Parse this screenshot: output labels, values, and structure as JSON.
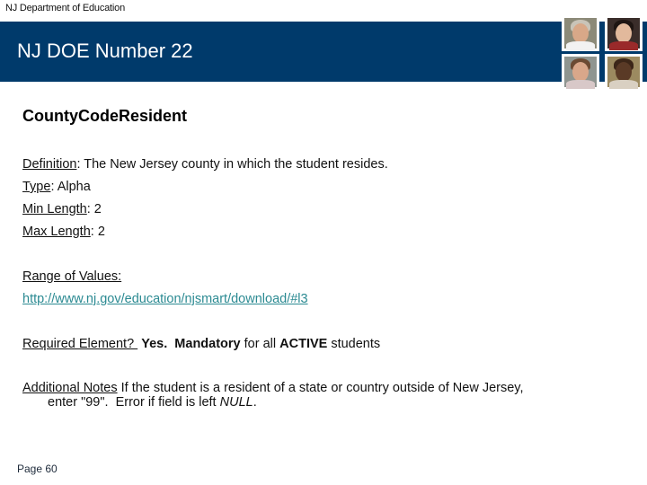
{
  "header": {
    "org_label": "NJ Department of Education",
    "banner_title": "NJ DOE Number 22",
    "banner_color": "#003a6b",
    "photos": [
      {
        "name": "photo-man-gray-hair"
      },
      {
        "name": "photo-woman-dark-hair"
      },
      {
        "name": "photo-woman-brown-hair"
      },
      {
        "name": "photo-older-man"
      }
    ]
  },
  "element": {
    "title": "CountyCodeResident",
    "definition_label": "Definition",
    "definition_value": ": The New Jersey county in which the student resides.",
    "type_label": "Type",
    "type_value": ": Alpha",
    "min_length_label": "Min Length",
    "min_length_value": ": 2",
    "max_length_label": "Max Length",
    "max_length_value": ": 2",
    "range_label": "Range of Values:",
    "range_link": "http://www.nj.gov/education/njsmart/download/#l3",
    "required_label": "Required Element? ",
    "required_yes": "Yes.",
    "required_mandatory": "Mandatory",
    "required_for_all": " for all ",
    "required_active": "ACTIVE",
    "required_students": " students",
    "notes_label": "Additional Notes",
    "notes_text_1": " If the student is a resident of a state or country outside of New Jersey,",
    "notes_text_2": "enter \"99\".  Error if field is left ",
    "notes_null": "NULL",
    "notes_end": "."
  },
  "footer": {
    "page_label": "Page 60"
  },
  "colors": {
    "link": "#2b8a92",
    "banner": "#003a6b"
  }
}
